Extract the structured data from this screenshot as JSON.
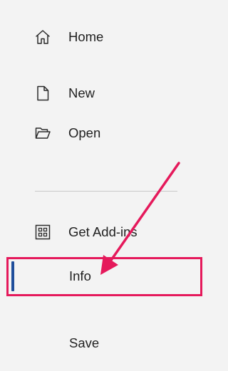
{
  "nav": {
    "items": [
      {
        "label": "Home",
        "icon": "home-icon"
      },
      {
        "label": "New",
        "icon": "new-document-icon"
      },
      {
        "label": "Open",
        "icon": "open-folder-icon"
      },
      {
        "label": "Get Add-ins",
        "icon": "add-ins-grid-icon"
      },
      {
        "label": "Info",
        "icon": null,
        "selected": true
      },
      {
        "label": "Save",
        "icon": null
      }
    ]
  },
  "colors": {
    "background": "#f3f3f3",
    "text": "#1f1f1f",
    "selected_bar": "#1f4e9b",
    "annotation": "#e5195b",
    "divider": "#c8c8c8"
  }
}
